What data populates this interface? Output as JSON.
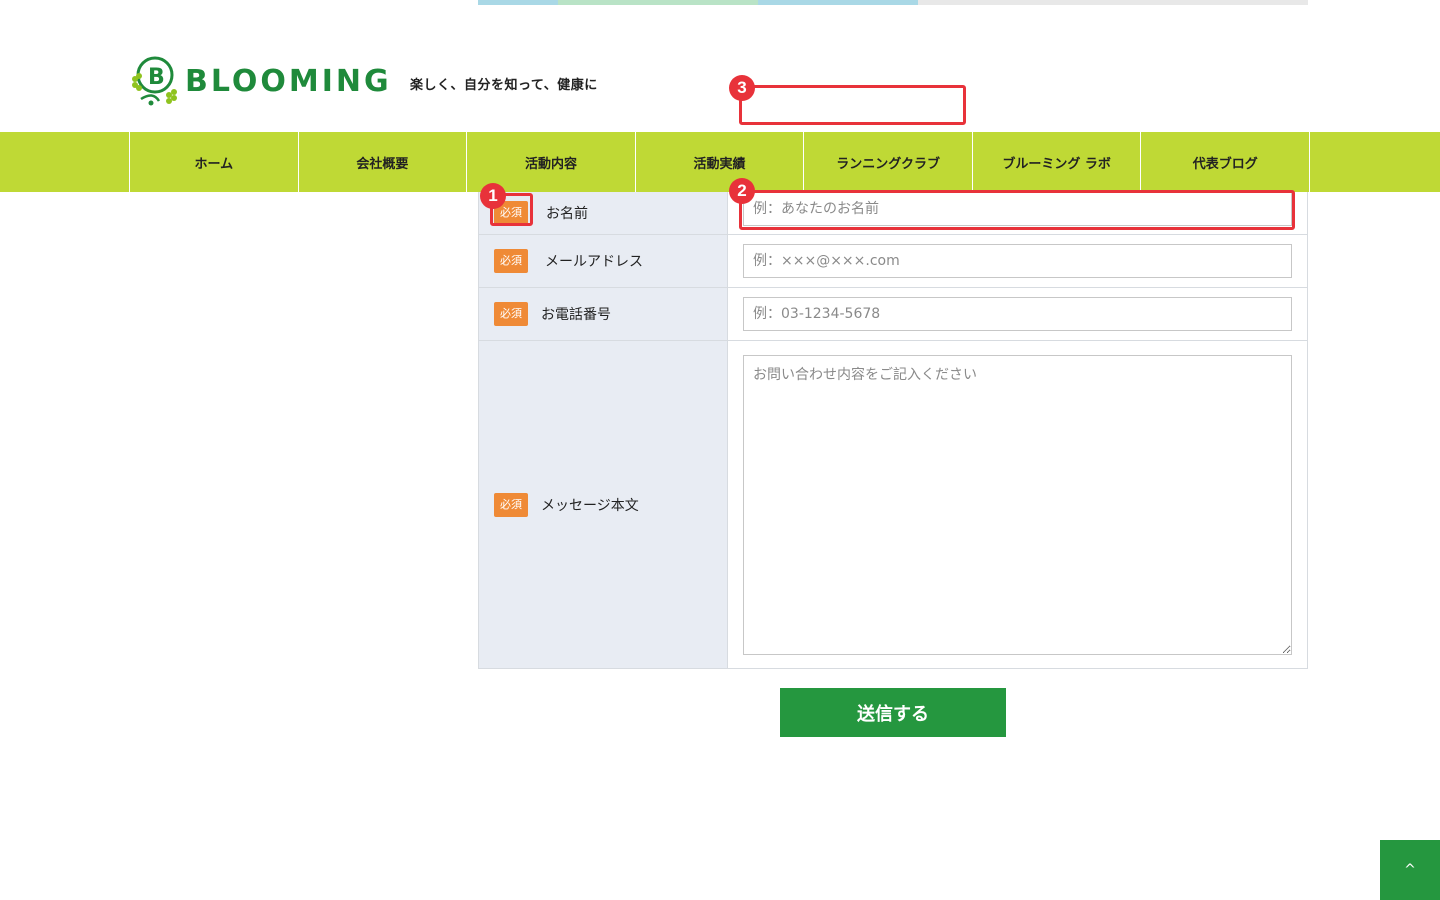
{
  "header": {
    "logo_text": "BLOOMING",
    "tagline": "楽しく、自分を知って、健康に"
  },
  "nav": {
    "items": [
      {
        "label": "ホーム"
      },
      {
        "label": "会社概要"
      },
      {
        "label": "活動内容"
      },
      {
        "label": "活動実績"
      },
      {
        "label": "ランニングクラブ"
      },
      {
        "label": "ブルーミング ラボ"
      },
      {
        "label": "代表ブログ"
      }
    ]
  },
  "form": {
    "required_badge": "必須",
    "fields": [
      {
        "label": "お名前",
        "placeholder": "例：あなたのお名前"
      },
      {
        "label": "メールアドレス",
        "placeholder": "例：×××@×××.com"
      },
      {
        "label": "お電話番号",
        "placeholder": "例：03-1234-5678"
      },
      {
        "label": "メッセージ本文",
        "placeholder": "お問い合わせ内容をご記入ください"
      }
    ],
    "submit_label": "送信する"
  },
  "annotations": {
    "one": "1",
    "two": "2",
    "three": "3"
  },
  "page_top": {
    "icon": "chevron-up-icon",
    "glyph": "^"
  },
  "colors": {
    "nav_bg": "#bfd935",
    "brand_green": "#25973f",
    "required_orange": "#ef8a36",
    "annotation_red": "#e8323a"
  }
}
